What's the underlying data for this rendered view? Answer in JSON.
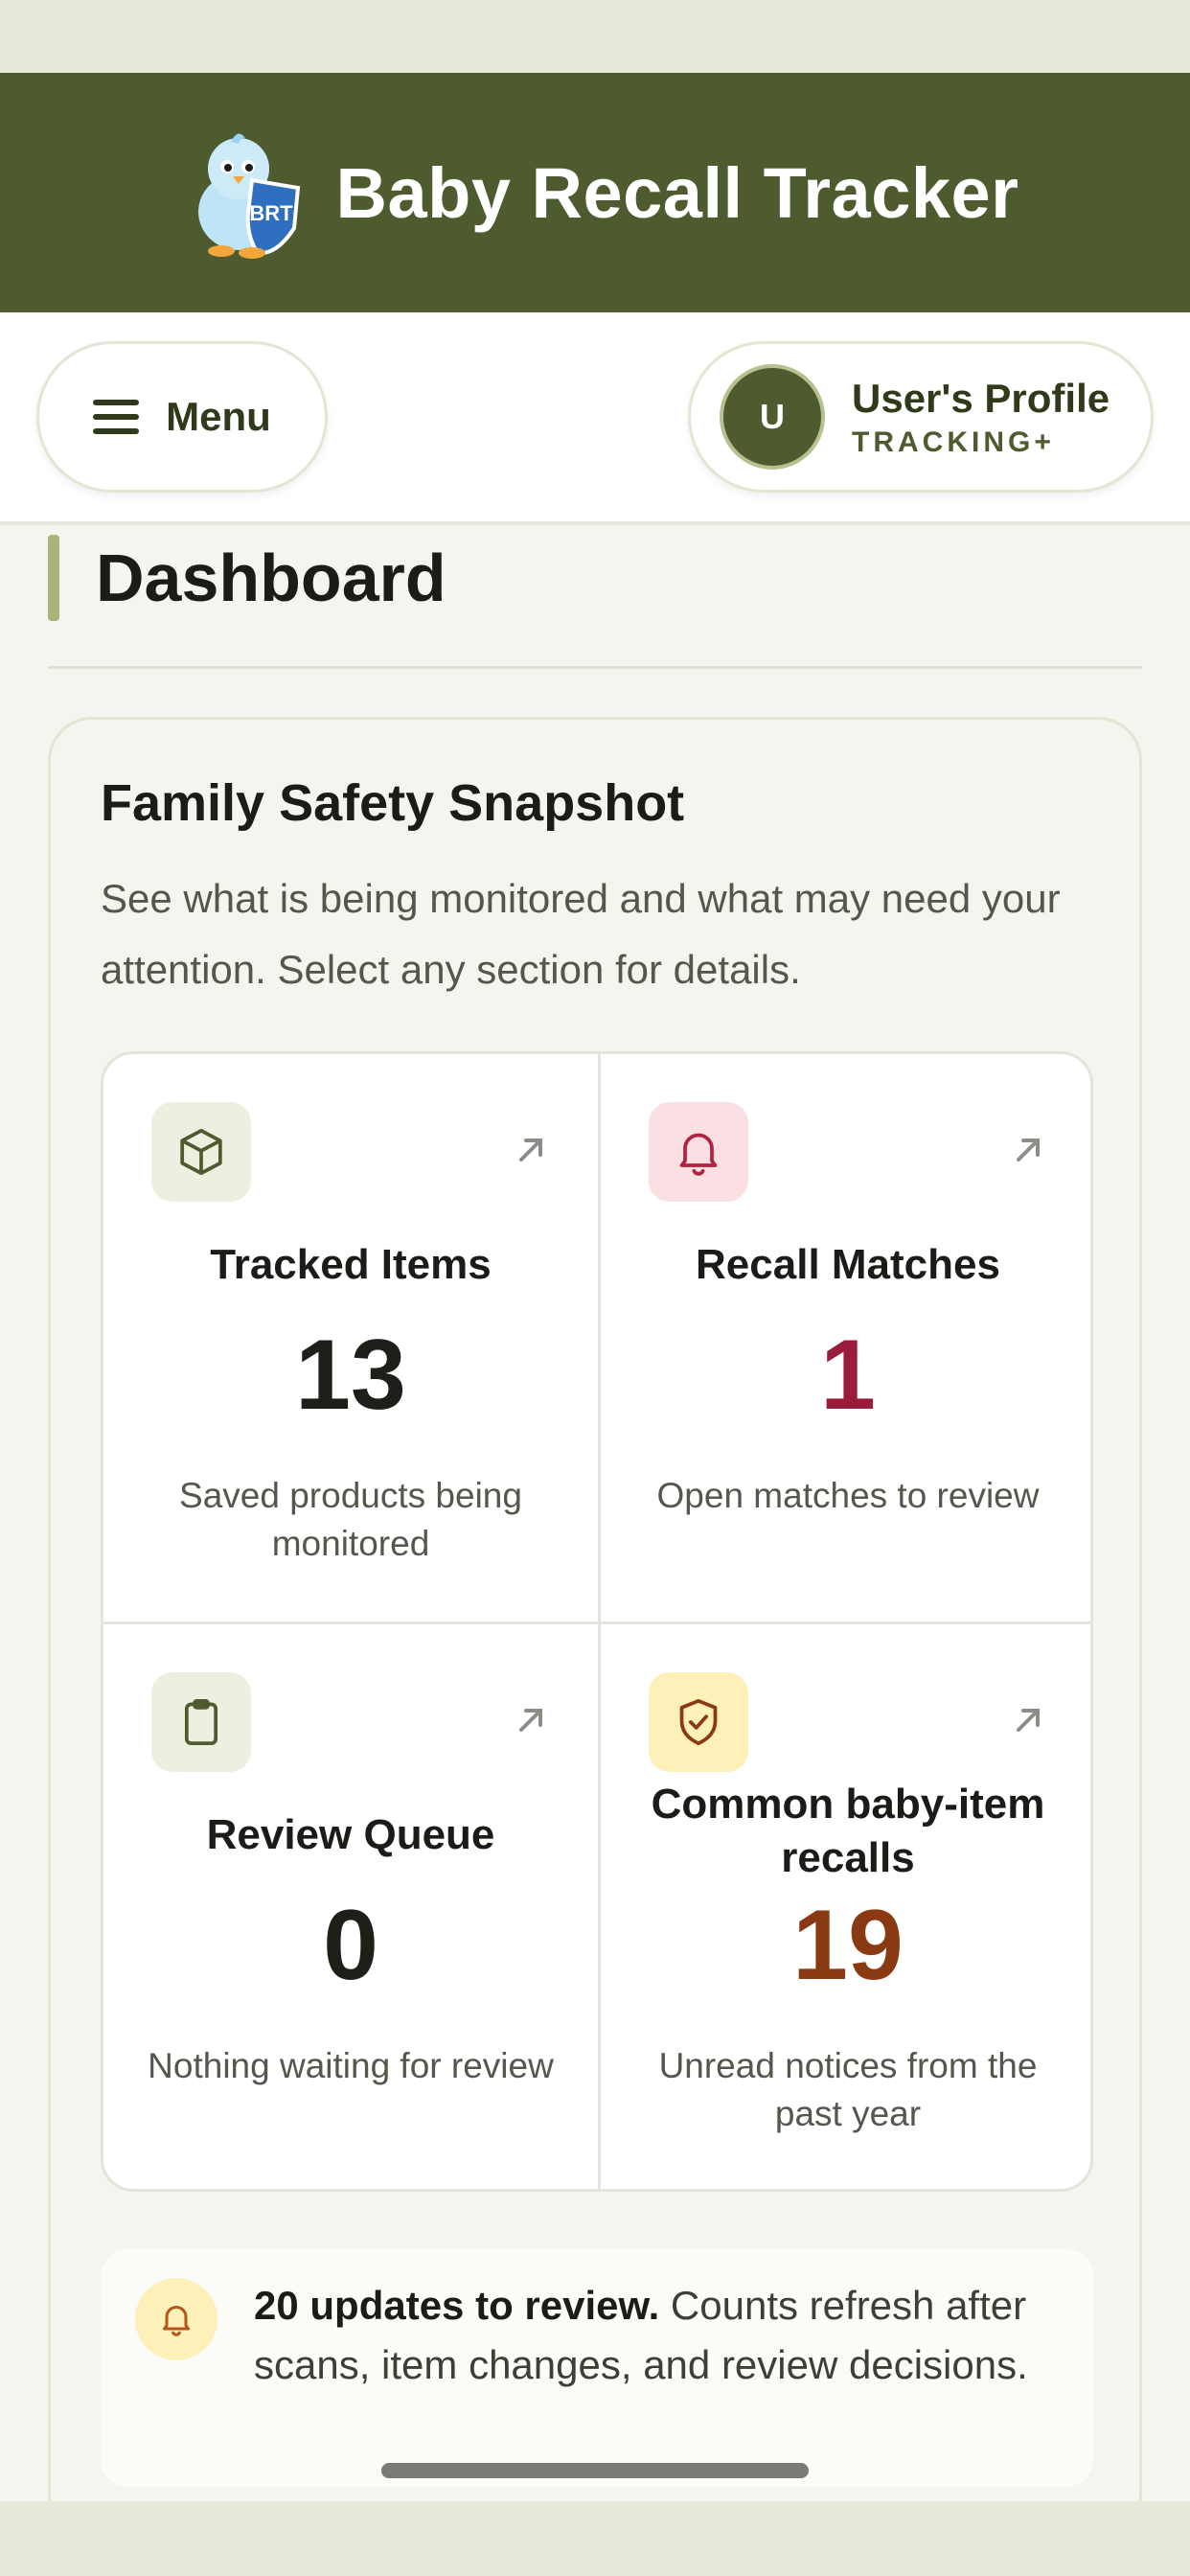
{
  "header": {
    "app_title": "Baby Recall Tracker",
    "logo_text": "BRT",
    "colors": {
      "header_bg": "#4d5b2f",
      "accent": "#a9b47a"
    }
  },
  "nav": {
    "menu_label": "Menu",
    "profile": {
      "avatar_initial": "U",
      "name": "User's Profile",
      "tier": "TRACKING+"
    }
  },
  "page": {
    "title": "Dashboard"
  },
  "snapshot": {
    "title": "Family Safety Snapshot",
    "description": "See what is being monitored and what may need your attention. Select any section for details.",
    "tiles": [
      {
        "icon": "box-icon",
        "label": "Tracked Items",
        "value": "13",
        "note": "Saved products being monitored",
        "value_color": "#111111"
      },
      {
        "icon": "bell-icon",
        "label": "Recall Matches",
        "value": "1",
        "note": "Open matches to review",
        "value_color": "#9b1b3a"
      },
      {
        "icon": "clipboard-icon",
        "label": "Review Queue",
        "value": "0",
        "note": "Nothing waiting for review",
        "value_color": "#111111"
      },
      {
        "icon": "shield-check-icon",
        "label": "Common baby-item recalls",
        "value": "19",
        "note": "Unread notices from the past year",
        "value_color": "#8a3a12"
      }
    ],
    "updates": {
      "icon": "bell-icon",
      "bold_text": "20 updates to review.",
      "text": " Counts refresh after scans, item changes, and review decisions."
    }
  }
}
